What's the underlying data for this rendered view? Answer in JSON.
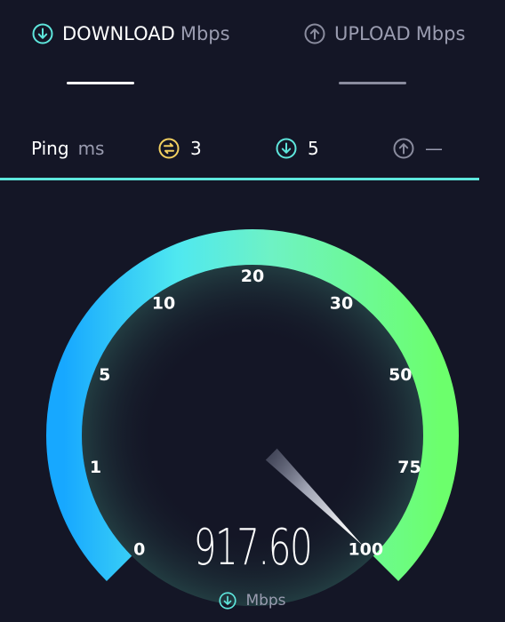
{
  "tabs": {
    "download": {
      "label": "DOWNLOAD",
      "unit": "Mbps",
      "icon": "download-icon",
      "active": true
    },
    "upload": {
      "label": "UPLOAD",
      "unit": "Mbps",
      "icon": "upload-icon",
      "active": false
    }
  },
  "ping": {
    "label": "Ping",
    "unit": "ms",
    "idle": {
      "value": "3",
      "icon": "ping-idle-icon",
      "color": "#f2d060"
    },
    "download": {
      "value": "5",
      "icon": "download-icon",
      "color": "#5ee6dc"
    },
    "upload": {
      "value": "—",
      "icon": "upload-icon",
      "color": "#8a8c9e"
    }
  },
  "gauge": {
    "ticks": [
      "0",
      "1",
      "5",
      "10",
      "20",
      "30",
      "50",
      "75",
      "100"
    ],
    "max_label": "100",
    "needle_fraction": 1.0,
    "speed": "917.60",
    "unit": "Mbps",
    "colors": {
      "start": "#17a8ff",
      "mid": "#5ff2dc",
      "end": "#6cff6c"
    }
  },
  "colors": {
    "background": "#141626",
    "accent": "#5ee6dc",
    "muted": "#9a9cb0"
  }
}
